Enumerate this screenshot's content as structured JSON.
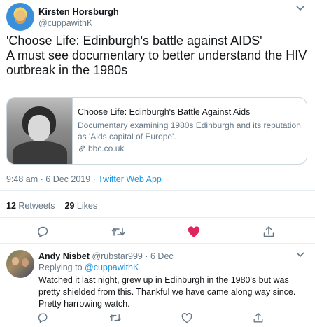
{
  "main_tweet": {
    "author_name": "Kirsten Horsburgh",
    "author_handle": "@cuppawithK",
    "text_line1": "'Choose Life: Edinburgh's battle against AIDS'",
    "text_line2": "A must see documentary to better understand the HIV outbreak in the 1980s",
    "card": {
      "title": "Choose Life: Edinburgh's Battle Against Aids",
      "description": "Documentary examining 1980s Edinburgh and its reputation as 'Aids capital of Europe'.",
      "domain": "bbc.co.uk"
    },
    "timestamp": "9:48 am · 6 Dec 2019 · ",
    "source_app": "Twitter Web App",
    "retweets_count": "12",
    "retweets_label": "Retweets",
    "likes_count": "29",
    "likes_label": "Likes",
    "liked": true
  },
  "reply_tweet": {
    "author_name": "Andy Nisbet",
    "author_handle": "@rubstar999",
    "date": "· 6 Dec",
    "replying_prefix": "Replying to ",
    "replying_handle": "@cuppawithK",
    "text": "Watched it last night, grew up in Edinburgh in the 1980's but was pretty shielded from this. Thankful we have came along way since. Pretty harrowing watch."
  },
  "colors": {
    "accent": "#1b95e0",
    "like_red": "#e0245e",
    "secondary_text": "#657786",
    "icon": "#657786"
  },
  "icons": {
    "reply": "speech-bubble",
    "retweet": "retweet-arrows",
    "like": "heart",
    "share": "share-upload",
    "more": "chevron-down",
    "link": "link-chain"
  }
}
